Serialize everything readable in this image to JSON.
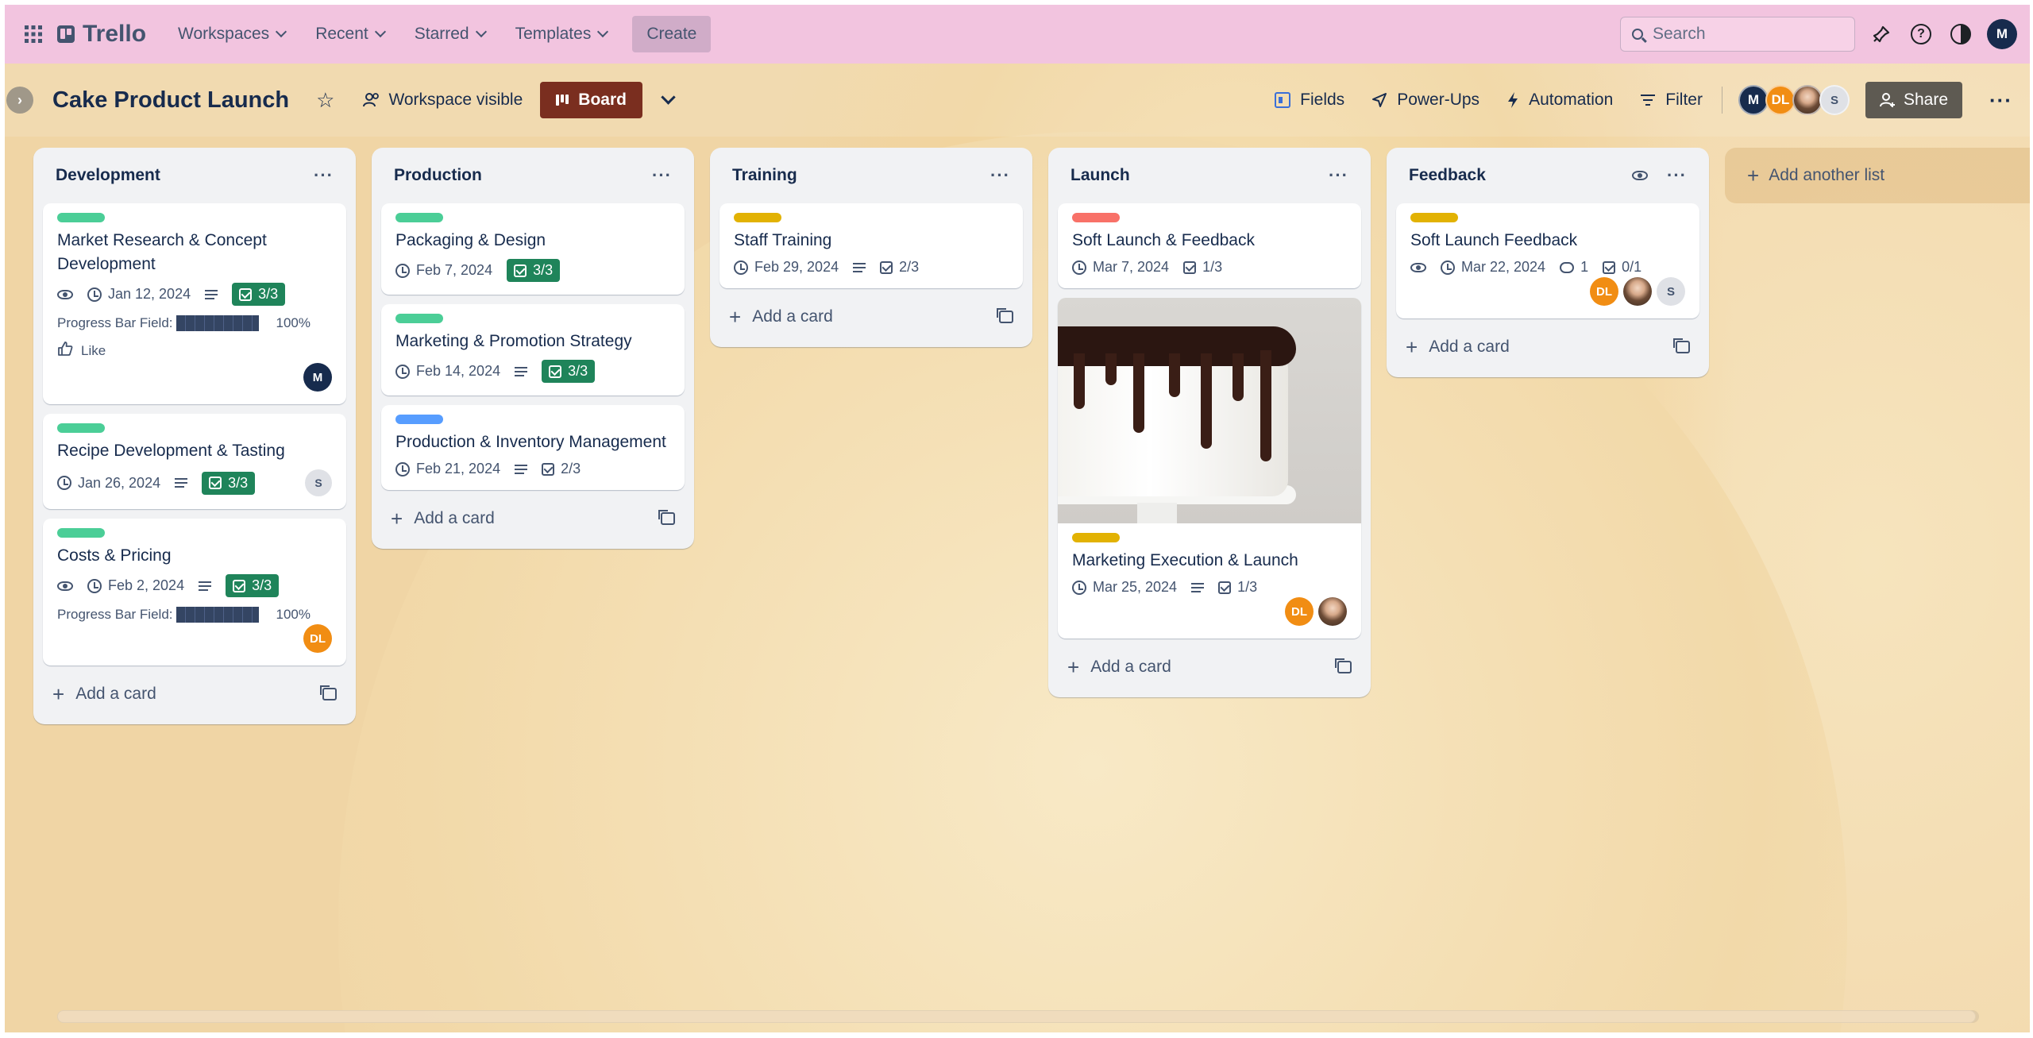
{
  "topnav": {
    "apps_icon": "grid-icon",
    "logo": "Trello",
    "menus": [
      {
        "label": "Workspaces"
      },
      {
        "label": "Recent"
      },
      {
        "label": "Starred"
      },
      {
        "label": "Templates"
      }
    ],
    "create_label": "Create",
    "search_placeholder": "Search",
    "right_icons": [
      "notifications-icon",
      "help-icon",
      "theme-icon"
    ],
    "user_initial": "M"
  },
  "board": {
    "title": "Cake Product Launch",
    "visibility": "Workspace visible",
    "view_label": "Board",
    "actions": {
      "fields": "Fields",
      "powerups": "Power-Ups",
      "automation": "Automation",
      "filter": "Filter",
      "share": "Share"
    },
    "members": [
      {
        "initials": "M"
      },
      {
        "initials": "DL"
      },
      {
        "initials": ""
      },
      {
        "initials": "S"
      }
    ]
  },
  "lists": [
    {
      "title": "Development",
      "add_card": "Add a card",
      "cards": [
        {
          "label_color": "#4bce97",
          "title": "Market Research & Concept Development",
          "date": "Jan 12, 2024",
          "checklist": "3/3",
          "progress_label": "Progress Bar Field:",
          "progress_value": "100%",
          "like": "Like",
          "member": "M"
        },
        {
          "label_color": "#4bce97",
          "title": "Recipe Development & Tasting",
          "date": "Jan 26, 2024",
          "checklist": "3/3",
          "member": "S"
        },
        {
          "label_color": "#4bce97",
          "title": "Costs & Pricing",
          "date": "Feb 2, 2024",
          "checklist": "3/3",
          "progress_label": "Progress Bar Field:",
          "progress_value": "100%",
          "member": "DL"
        }
      ]
    },
    {
      "title": "Production",
      "add_card": "Add a card",
      "cards": [
        {
          "label_color": "#4bce97",
          "title": "Packaging & Design",
          "date": "Feb 7, 2024",
          "checklist": "3/3"
        },
        {
          "label_color": "#4bce97",
          "title": "Marketing & Promotion Strategy",
          "date": "Feb 14, 2024",
          "checklist": "3/3"
        },
        {
          "label_color": "#579dff",
          "title": "Production & Inventory Management",
          "date": "Feb 21, 2024",
          "checklist": "2/3"
        }
      ]
    },
    {
      "title": "Training",
      "add_card": "Add a card",
      "cards": [
        {
          "label_color": "#e2b203",
          "title": "Staff Training",
          "date": "Feb 29, 2024",
          "checklist": "2/3"
        }
      ]
    },
    {
      "title": "Launch",
      "add_card": "Add a card",
      "cards": [
        {
          "label_color": "#f87168",
          "title": "Soft Launch & Feedback",
          "date": "Mar 7, 2024",
          "checklist": "1/3"
        },
        {
          "label_color": "#e2b203",
          "title": "Marketing Execution & Launch",
          "date": "Mar 25, 2024",
          "checklist": "1/3",
          "members": [
            "DL",
            ""
          ]
        }
      ]
    },
    {
      "title": "Feedback",
      "add_card": "Add a card",
      "cards": [
        {
          "label_color": "#e2b203",
          "title": "Soft Launch Feedback",
          "date": "Mar 22, 2024",
          "comments": "1",
          "checklist": "0/1",
          "members": [
            "DL",
            "",
            "S"
          ]
        }
      ]
    }
  ],
  "add_list": "Add another list"
}
